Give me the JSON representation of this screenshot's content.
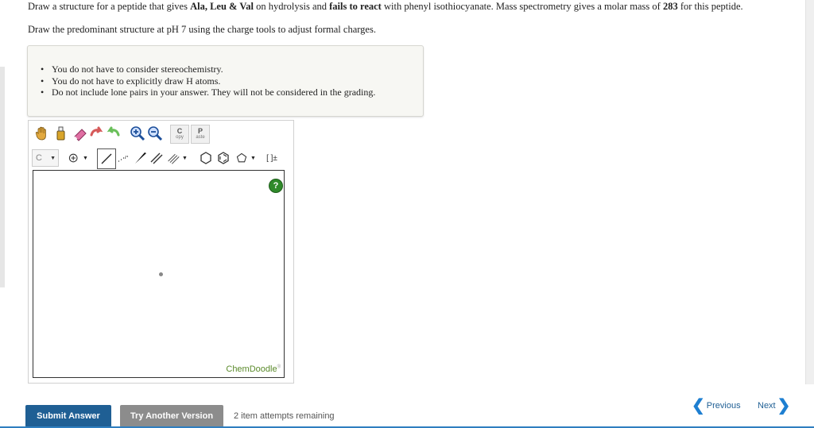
{
  "question": {
    "line1_pre": "Draw a structure for a peptide that gives ",
    "line1_bold1": "Ala, Leu & Val",
    "line1_mid": " on hydrolysis and ",
    "line1_bold2": "fails to react",
    "line1_mid2": " with phenyl isothiocyanate. Mass spectrometry gives a molar mass of ",
    "line1_bold3": "283",
    "line1_post": " for this peptide.",
    "line2": "Draw the predominant structure at pH 7 using the charge tools to adjust formal charges."
  },
  "instructions": [
    "You do not have to consider stereochemistry.",
    "You do not have to explicitly draw H atoms.",
    "Do not include lone pairs in your answer. They will not be considered in the grading."
  ],
  "toolbar": {
    "copy_top": "C",
    "copy_bottom": "opy",
    "paste_top": "P",
    "paste_bottom": "aste",
    "element_label": "C",
    "bracket_label": "[ ]±"
  },
  "canvas": {
    "help": "?",
    "brand": "ChemDoodle"
  },
  "footer": {
    "submit": "Submit Answer",
    "try_another": "Try Another Version",
    "attempts": "2 item attempts remaining",
    "previous": "Previous",
    "next": "Next"
  },
  "colors": {
    "primary": "#1f5f94",
    "secondary_button": "#8c8c8c",
    "brand_green": "#5a8a2a",
    "help_green": "#2f8a2a"
  }
}
